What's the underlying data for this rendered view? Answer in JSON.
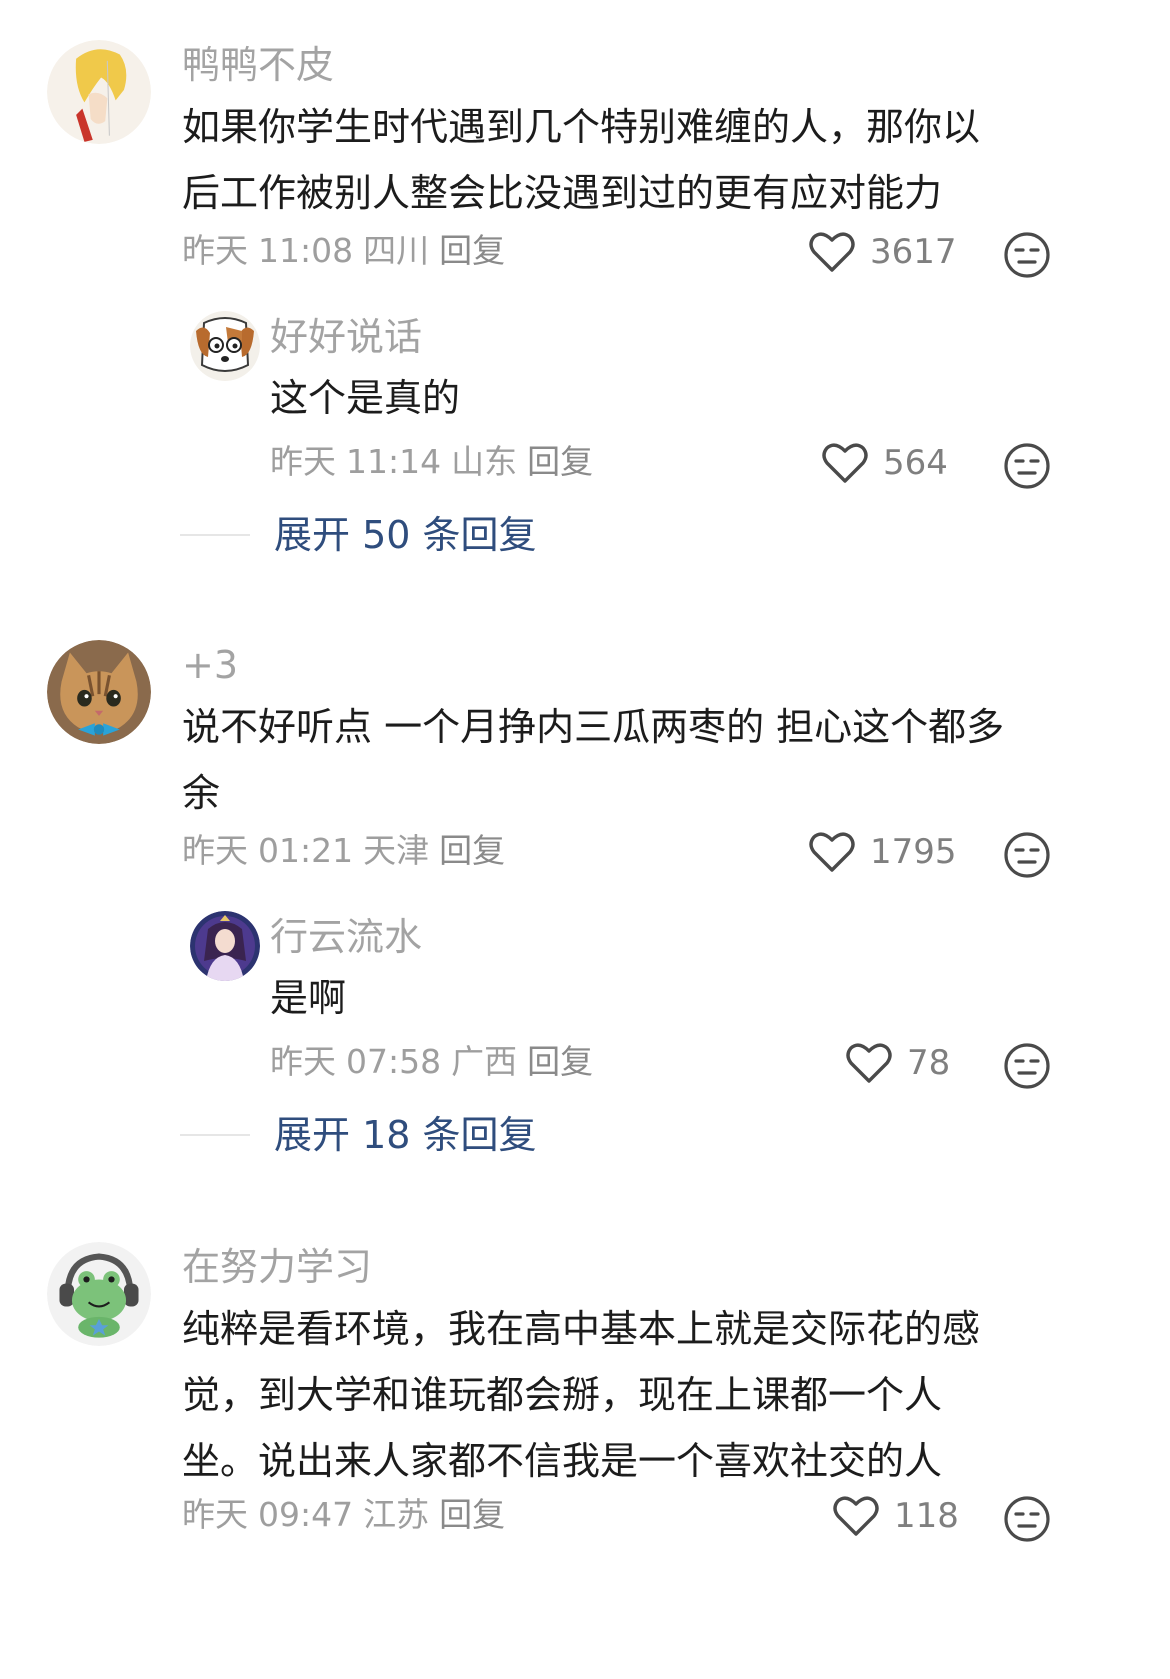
{
  "comments": [
    {
      "username": "鸭鸭不皮",
      "content_lines": [
        "如果你学生时代遇到几个特别难缠的人，那你以",
        "后工作被别人整会比没遇到过的更有应对能力"
      ],
      "date": "昨天",
      "time": "11:08",
      "location": "四川",
      "reply_label": "回复",
      "likes": "3617",
      "replies": [
        {
          "username": "好好说话",
          "content": "这个是真的",
          "date": "昨天",
          "time": "11:14",
          "location": "山东",
          "reply_label": "回复",
          "likes": "564"
        }
      ],
      "expand_label": "展开 50 条回复"
    },
    {
      "username": "+3",
      "content_lines": [
        "说不好听点 一个月挣内三瓜两枣的 担心这个都多",
        "余"
      ],
      "date": "昨天",
      "time": "01:21",
      "location": "天津",
      "reply_label": "回复",
      "likes": "1795",
      "replies": [
        {
          "username": "行云流水",
          "content": "是啊",
          "date": "昨天",
          "time": "07:58",
          "location": "广西",
          "reply_label": "回复",
          "likes": "78"
        }
      ],
      "expand_label": "展开 18 条回复"
    },
    {
      "username": "在努力学习",
      "content_lines": [
        "纯粹是看环境，我在高中基本上就是交际花的感",
        "觉，到大学和谁玩都会掰，现在上课都一个人",
        "坐。说出来人家都不信我是一个喜欢社交的人"
      ],
      "date": "昨天",
      "time": "09:47",
      "location": "江苏",
      "reply_label": "回复",
      "likes": "118"
    }
  ],
  "icons": {
    "like": "heart-outline-icon",
    "reaction": "neutral-face-emoji-icon",
    "avatar_1": "anime-blonde-avatar",
    "avatar_1_reply": "cartoon-dog-avatar",
    "avatar_2": "cat-bowtie-avatar",
    "avatar_2_reply": "anime-girl-avatar",
    "avatar_3": "green-frog-headphones-avatar"
  },
  "colors": {
    "username": "#a3a3a3",
    "content": "#1c1c1c",
    "meta": "#9e9e9e",
    "expand_link": "#2f4d7d",
    "icon_stroke": "#4a4a4a"
  }
}
